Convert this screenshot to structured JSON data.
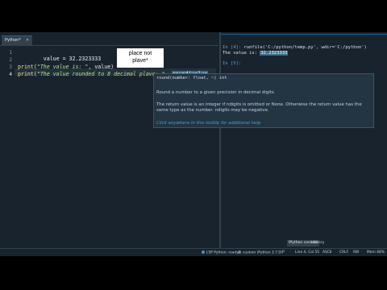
{
  "editor": {
    "tab_label": "Python*",
    "tab_close": "✕",
    "line_numbers": [
      "1",
      "2",
      "3",
      "4"
    ],
    "lines": {
      "l1": "value = 32.2323333",
      "l3_fn": "print",
      "l3_open": "(",
      "l3_str": "\"The value is: \"",
      "l3_rest": ", value)",
      "l4_fn": "print",
      "l4_open": "(",
      "l4_str": "\"The value rounded to 8 decimal plave: \"",
      "l4_rest": ", ",
      "l4_hl": "round(value"
    }
  },
  "annotation": {
    "text_line1": "place not",
    "text_line2": "plave*"
  },
  "tooltip": {
    "signature": "round(number: float, ~) int",
    "para1": "Round a number to a given precision in decimal digits.",
    "para2": "The return value is an integer if ndigits is omitted or None. Otherwise the return value has the same type as the number. ndigits may be negative.",
    "link": "Click anywhere in this tooltip for additional help"
  },
  "console": {
    "in4_prompt": "In [4]:",
    "in4_cmd": "runfile('C:/python/temp.py', wdir='C:/python')",
    "out_label": "The value is: ",
    "out_value": "32.2323333",
    "in5_prompt": "In [5]:",
    "tabs": [
      "IPython console",
      "History"
    ]
  },
  "statusbar": {
    "lsp": "LSP Python: ready",
    "env": "custom (Python 3.7.9)",
    "vcs": "P",
    "position": "Line 4, Col 55",
    "encoding": "ASCII",
    "eol": "CRLF",
    "perm": "RW",
    "mem": "Mem 48%"
  },
  "colors": {
    "background": "#19232d",
    "accent": "#1464a0",
    "keyword": "#f0e68c",
    "string": "#b0e686"
  }
}
